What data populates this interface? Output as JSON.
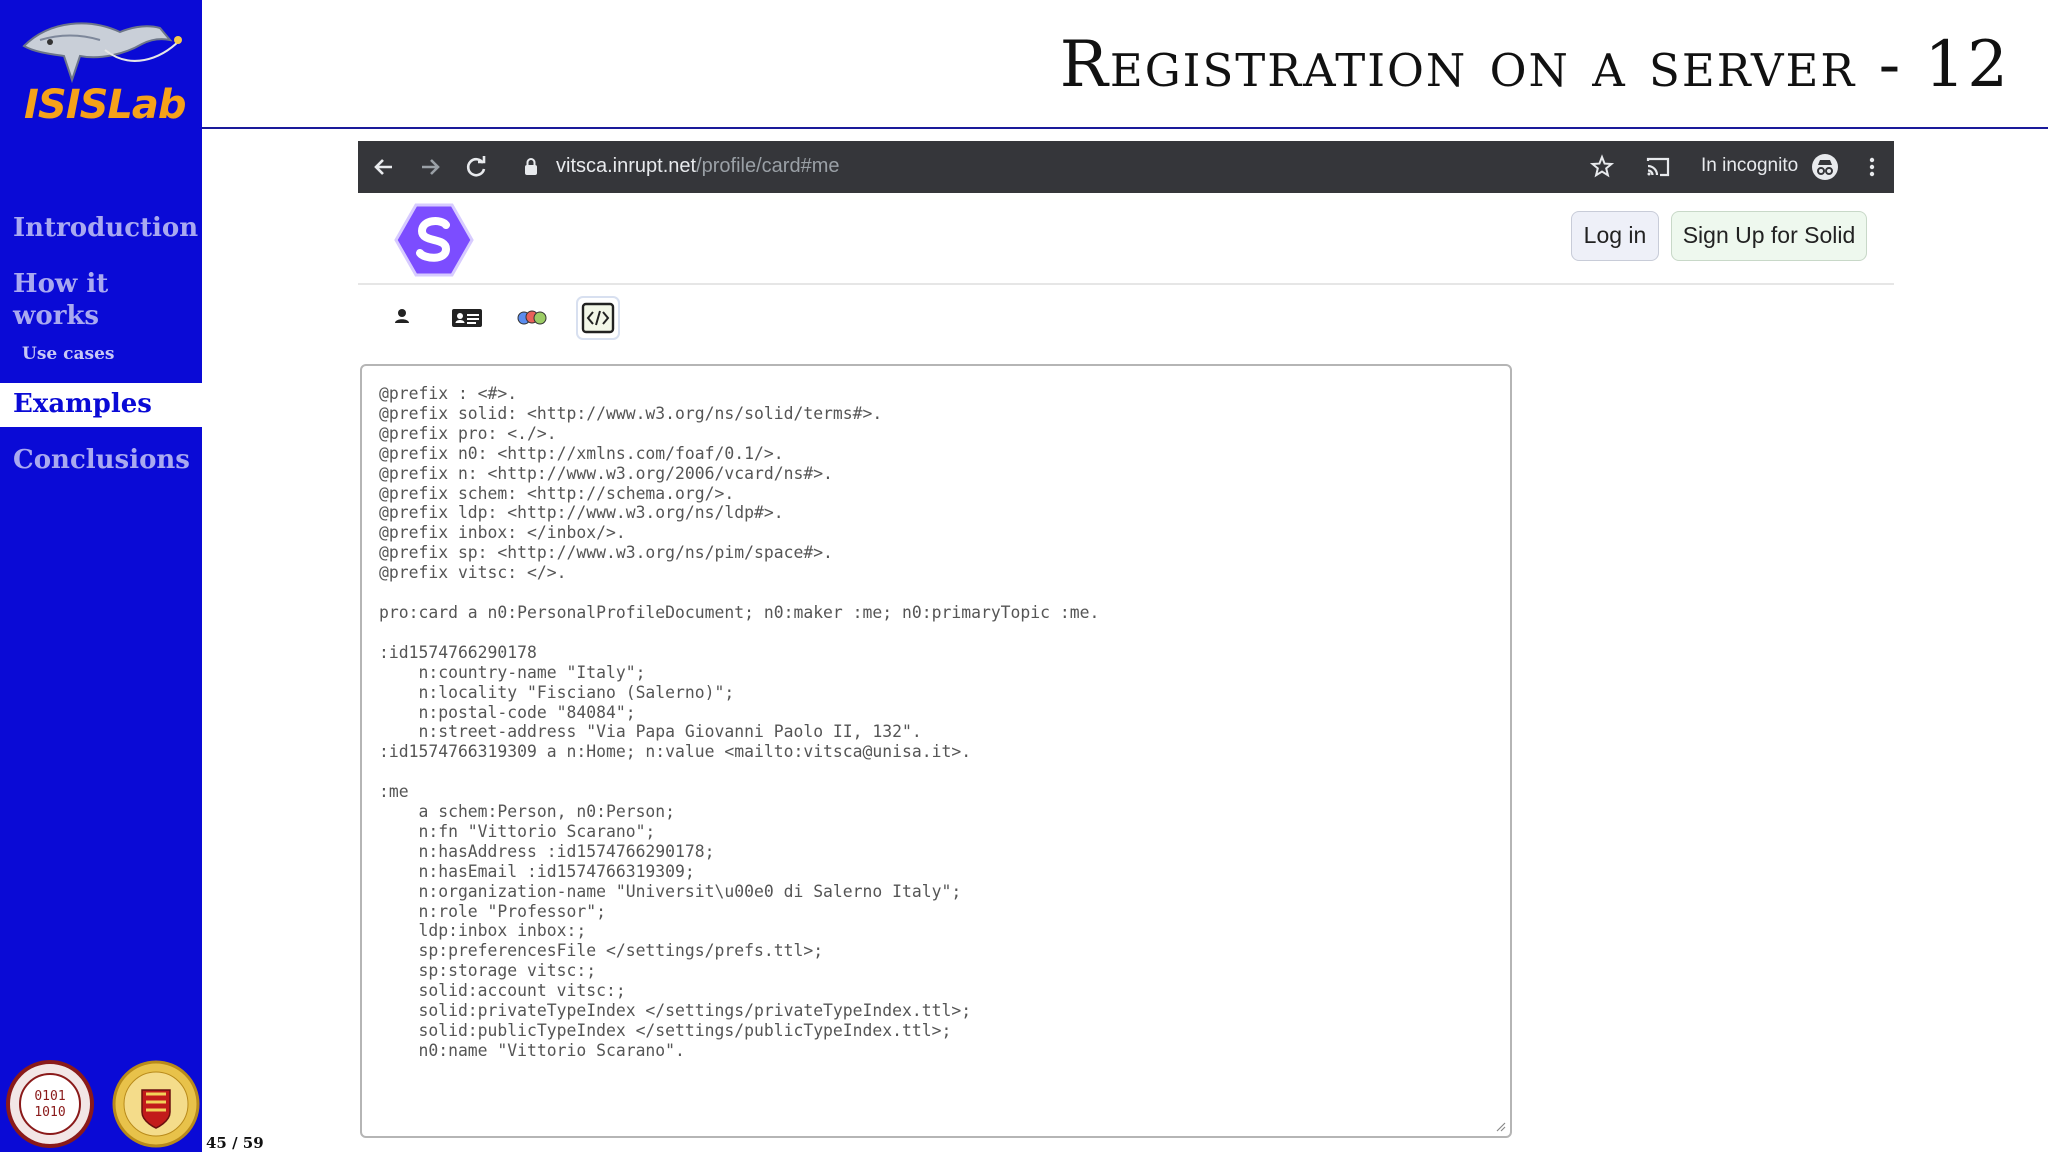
{
  "sidebar": {
    "logo_text": "ISISLab",
    "nav": [
      {
        "label": "Introduction"
      },
      {
        "label": "How it\nworks"
      },
      {
        "label": "Use cases"
      },
      {
        "label": "Examples"
      },
      {
        "label": "Conclusions"
      }
    ],
    "active_item": "Examples"
  },
  "slide": {
    "title": "Registration on a server - 12",
    "page_number": "45 / 59"
  },
  "browser": {
    "url_host": "vitsca.inrupt.net",
    "url_path": "/profile/card#me",
    "incognito_label": "In incognito",
    "icons": [
      "back-icon",
      "forward-icon",
      "reload-icon",
      "lock-icon",
      "star-icon",
      "cast-icon",
      "incognito-icon",
      "menu-icon"
    ]
  },
  "solid_page": {
    "login_label": "Log in",
    "signup_label": "Sign Up for Solid",
    "tabs": [
      "person-icon",
      "contact-card-icon",
      "groups-icon",
      "code-icon"
    ],
    "active_tab": "code-icon",
    "source_code": "@prefix : <#>.\n@prefix solid: <http://www.w3.org/ns/solid/terms#>.\n@prefix pro: <./>.\n@prefix n0: <http://xmlns.com/foaf/0.1/>.\n@prefix n: <http://www.w3.org/2006/vcard/ns#>.\n@prefix schem: <http://schema.org/>.\n@prefix ldp: <http://www.w3.org/ns/ldp#>.\n@prefix inbox: </inbox/>.\n@prefix sp: <http://www.w3.org/ns/pim/space#>.\n@prefix vitsc: </>.\n\npro:card a n0:PersonalProfileDocument; n0:maker :me; n0:primaryTopic :me.\n\n:id1574766290178\n    n:country-name \"Italy\";\n    n:locality \"Fisciano (Salerno)\";\n    n:postal-code \"84084\";\n    n:street-address \"Via Papa Giovanni Paolo II, 132\".\n:id1574766319309 a n:Home; n:value <mailto:vitsca@unisa.it>.\n\n:me\n    a schem:Person, n0:Person;\n    n:fn \"Vittorio Scarano\";\n    n:hasAddress :id1574766290178;\n    n:hasEmail :id1574766319309;\n    n:organization-name \"Universit\\u00e0 di Salerno Italy\";\n    n:role \"Professor\";\n    ldp:inbox inbox:;\n    sp:preferencesFile </settings/prefs.ttl>;\n    sp:storage vitsc:;\n    solid:account vitsc:;\n    solid:privateTypeIndex </settings/privateTypeIndex.ttl>;\n    solid:publicTypeIndex </settings/publicTypeIndex.ttl>;\n    n0:name \"Vittorio Scarano\"."
  },
  "colors": {
    "sidebar_bg": "#0a0ad6",
    "nav_text": "#a9a9f0",
    "logo_orange": "#f5a21a",
    "solid_purple": "#7c4dff",
    "browser_bar": "#35363a"
  }
}
